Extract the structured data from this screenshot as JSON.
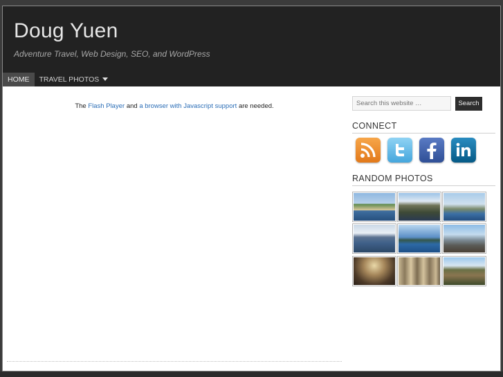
{
  "header": {
    "site_title": "Doug Yuen",
    "tagline": "Adventure Travel, Web Design, SEO, and WordPress"
  },
  "nav": {
    "items": [
      {
        "label": "HOME"
      },
      {
        "label": "TRAVEL PHOTOS"
      }
    ]
  },
  "main": {
    "flash_prefix": "The",
    "flash_link1": "Flash Player",
    "flash_middle": "and",
    "flash_link2": "a browser with Javascript support",
    "flash_suffix": "are needed."
  },
  "sidebar": {
    "search_placeholder": "Search this website …",
    "search_button": "Search",
    "connect_title": "CONNECT",
    "social_icons": [
      "rss-icon",
      "twitter-icon",
      "facebook-icon",
      "linkedin-icon"
    ],
    "photos_title": "RANDOM PHOTOS"
  },
  "colors": {
    "header_bg": "#222222",
    "link": "#2a6db6",
    "rss": "#f08a24",
    "twitter": "#5fb8e6",
    "facebook": "#3b5ca6",
    "linkedin": "#0a6ea0"
  }
}
